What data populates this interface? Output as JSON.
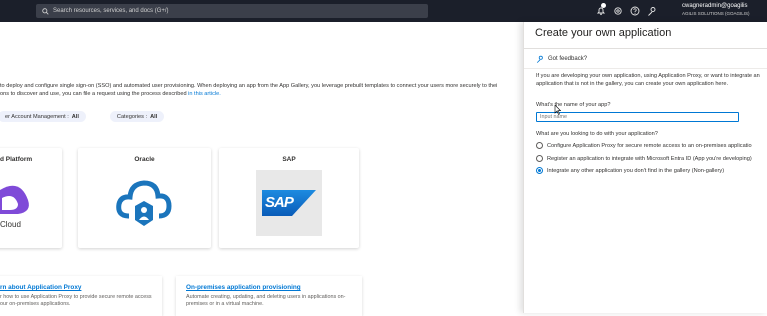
{
  "topbar": {
    "search_placeholder": "Search resources, services, and docs (G+/)",
    "account_user": "cwagneradmin@goagilis",
    "account_org": "AGILIS SOLUTIONS (GOAGILIS)"
  },
  "main": {
    "description_text": "to deploy and configure single sign-on (SSO) and automated user provisioning. When deploying an app from the App Gallery, you leverage prebuilt templates to connect your users more securely to thei",
    "description_text2": "ons to discover and use, you can file a request using the process described",
    "description_link": "in this article.",
    "filters": [
      {
        "label": "er Account Management :",
        "value": "All"
      },
      {
        "label": "Categories :",
        "value": "All"
      }
    ],
    "cards": [
      {
        "title": "d Platform",
        "logo_text": "Cloud"
      },
      {
        "title": "Oracle"
      },
      {
        "title": "SAP",
        "logo_text": "SAP"
      }
    ],
    "promos": [
      {
        "title": "rn about Application Proxy",
        "text": "r how to use Application Proxy to provide secure remote access",
        "text2": "our on-premises applications."
      },
      {
        "title": "On-premises application provisioning",
        "text": "Automate creating, updating, and deleting users in applications on-",
        "text2": "premises or in a virtual machine."
      }
    ]
  },
  "panel": {
    "title": "Create your own application",
    "feedback_label": "Got feedback?",
    "intro": "If you are developing your own application, using Application Proxy, or want to integrate an application that is not in the gallery, you can create your own application here.",
    "name_question": "What's the name of your app?",
    "name_placeholder": "Input name",
    "purpose_question": "What are you looking to do with your application?",
    "options": [
      {
        "label": "Configure Application Proxy for secure remote access to an on-premises applicatio",
        "selected": false
      },
      {
        "label": "Register an application to integrate with Microsoft Entra ID (App you're developing)",
        "selected": false
      },
      {
        "label": "Integrate any other application you don't find in the gallery (Non-gallery)",
        "selected": true
      }
    ]
  },
  "colors": {
    "accent": "#0078d4",
    "topbar": "#1b1f2a",
    "oracle_blue": "#1b75bc",
    "sap_blue": "#0a6ed1",
    "purple": "#7f4ad8"
  }
}
